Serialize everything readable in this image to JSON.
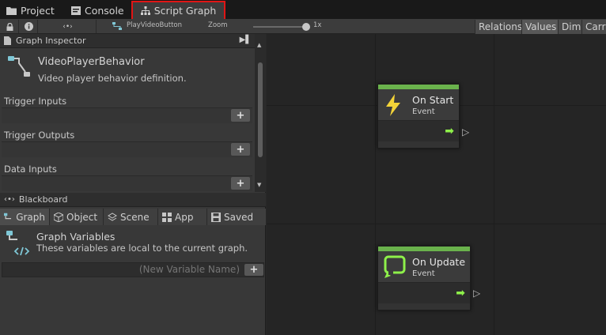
{
  "tabs": [
    {
      "label": "Project",
      "icon": "folder-icon"
    },
    {
      "label": "Console",
      "icon": "console-icon"
    },
    {
      "label": "Script Graph",
      "icon": "graph-icon"
    }
  ],
  "toolbar": {
    "nav_symbol": "‹•›",
    "graph_name": "PlayVideoButton",
    "zoom_label": "Zoom",
    "zoom_value": "1x",
    "right_buttons": [
      "Relations",
      "Values",
      "Dim",
      "Carry"
    ]
  },
  "inspector": {
    "header": "Graph Inspector",
    "graph_title": "VideoPlayerBehavior",
    "graph_description": "Video player behavior definition.",
    "sections": [
      "Trigger Inputs",
      "Trigger Outputs",
      "Data Inputs"
    ],
    "add_symbol": "+"
  },
  "blackboard": {
    "header": "Blackboard",
    "tabs": [
      "Graph",
      "Object",
      "Scene",
      "App",
      "Saved"
    ],
    "variables_title": "Graph Variables",
    "variables_desc": "These variables are local to the current graph.",
    "new_variable_placeholder": "(New Variable Name)",
    "add_symbol": "+"
  },
  "nodes": [
    {
      "title": "On Start",
      "subtitle": "Event",
      "icon": "lightning-icon"
    },
    {
      "title": "On Update",
      "subtitle": "Event",
      "icon": "loop-icon"
    }
  ],
  "colors": {
    "accent_green": "#6ab24c",
    "highlight_red": "#e01515",
    "flow_arrow": "#8ef04a"
  }
}
